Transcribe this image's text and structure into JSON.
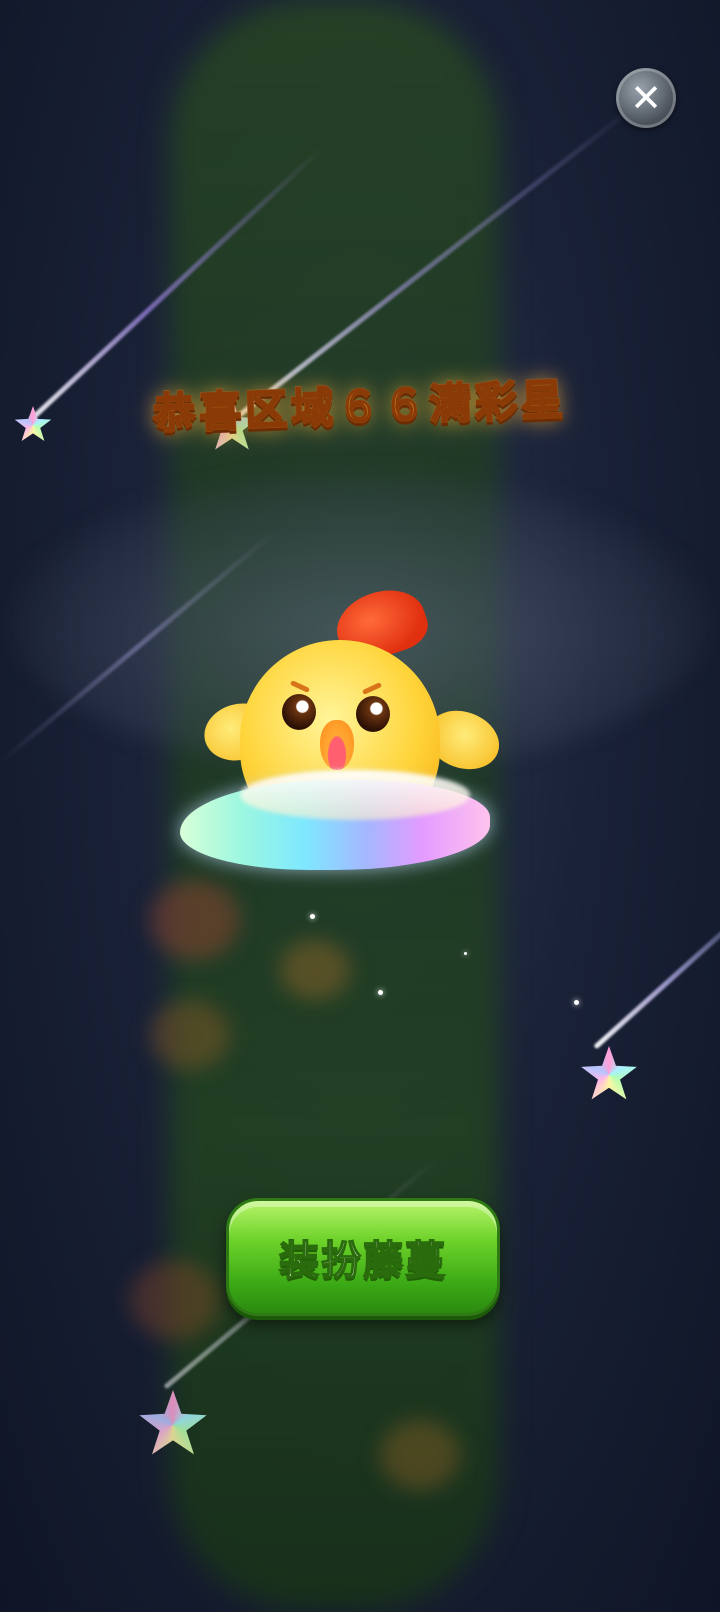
{
  "dialog": {
    "title": "恭喜区域６６满彩星",
    "close_icon": "close-icon",
    "action_button_label": "装扮藤蔓"
  },
  "scene": {
    "character": "yellow-chick-on-rainbow-cloud",
    "decorations": [
      "rainbow-star-icon",
      "shooting-star-streak"
    ]
  },
  "colors": {
    "title_gradient": [
      "#fff7b8",
      "#ffd04d",
      "#ff9d1a"
    ],
    "button_green": "#4bb81c",
    "background": "#1a2238"
  }
}
